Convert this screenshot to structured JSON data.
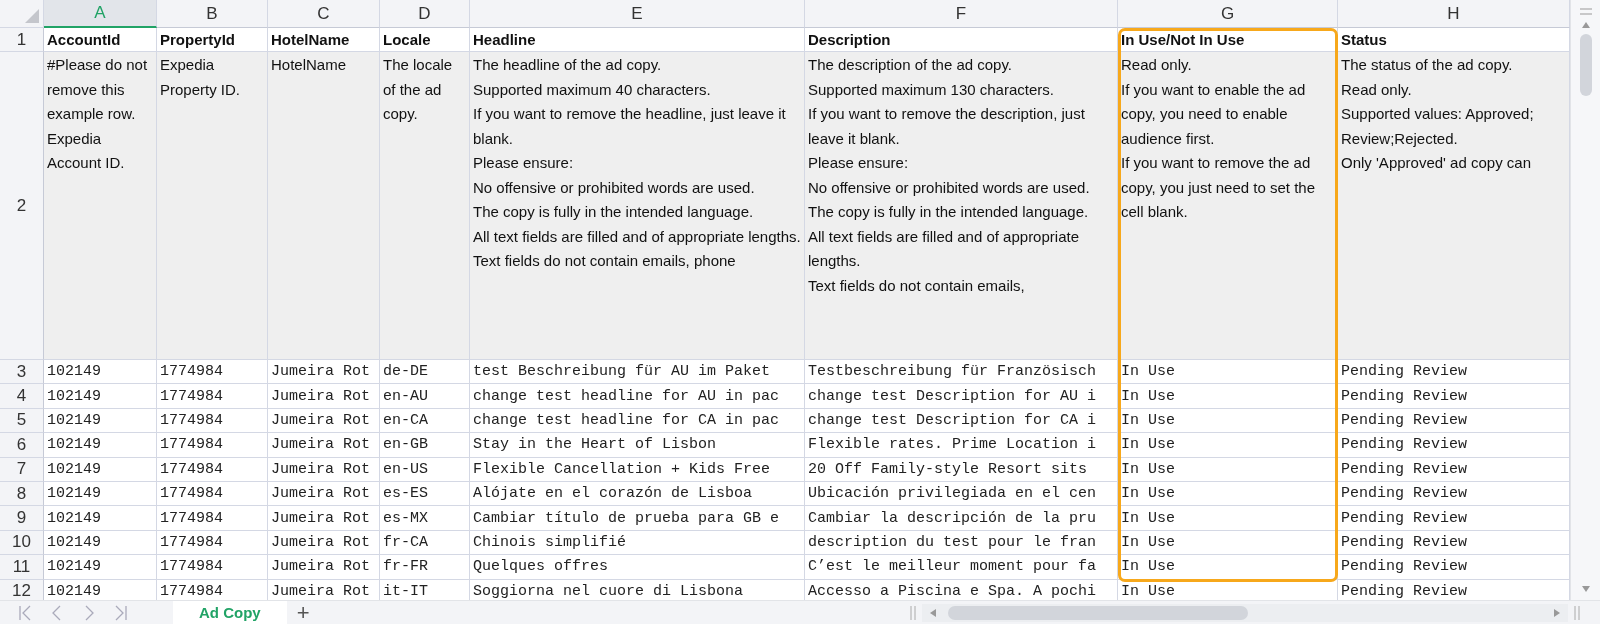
{
  "columns": [
    {
      "label": "A",
      "selected": true,
      "highlighted": false
    },
    {
      "label": "B",
      "selected": false,
      "highlighted": false
    },
    {
      "label": "C",
      "selected": false,
      "highlighted": false
    },
    {
      "label": "D",
      "selected": false,
      "highlighted": false
    },
    {
      "label": "E",
      "selected": false,
      "highlighted": false
    },
    {
      "label": "F",
      "selected": false,
      "highlighted": false
    },
    {
      "label": "G",
      "selected": false,
      "highlighted": true
    },
    {
      "label": "H",
      "selected": false,
      "highlighted": false
    }
  ],
  "rows": [
    {
      "number": "1",
      "kind": "header",
      "cells": [
        "AccountId",
        "PropertyId",
        "HotelName",
        "Locale",
        "Headline",
        "Description",
        "In Use/Not In Use",
        "Status"
      ]
    },
    {
      "number": "2",
      "kind": "notes",
      "cells": [
        "#Please do not remove this example row.\nExpedia Account ID.",
        "Expedia Property ID.",
        "HotelName",
        "The locale of the ad copy.",
        "The headline of the ad copy.\nSupported maximum 40 characters.\nIf you want to remove the headline, just leave it blank.\nPlease ensure:\nNo offensive or prohibited words are used.\nThe copy is fully in the intended language.\nAll text fields are filled and of appropriate lengths.\nText fields do not contain emails, phone",
        "The description of the ad copy.\nSupported maximum 130 characters.\nIf you want to remove the description, just leave it blank.\nPlease ensure:\nNo offensive or prohibited words are used.\nThe copy is fully in the intended language.\nAll text fields are filled and of appropriate lengths.\nText fields do not contain emails,",
        "Read only.\nIf you want to enable the ad copy, you need to enable audience first.\nIf you want to remove the ad copy, you just need to set the cell blank.",
        "The status of the ad copy.\nRead only.\nSupported values: Approved;\nReview;Rejected.\nOnly 'Approved' ad copy can"
      ]
    },
    {
      "number": "3",
      "kind": "data",
      "cells": [
        "102149",
        "1774984",
        "Jumeira Rot",
        "de-DE",
        "test Beschreibung für AU im Paket",
        "Testbeschreibung für Französisch",
        "In Use",
        "Pending Review"
      ]
    },
    {
      "number": "4",
      "kind": "data",
      "cells": [
        "102149",
        "1774984",
        "Jumeira Rot",
        "en-AU",
        "change test headline for AU in pac",
        "change test Description for AU i",
        "In Use",
        "Pending Review"
      ]
    },
    {
      "number": "5",
      "kind": "data",
      "cells": [
        "102149",
        "1774984",
        "Jumeira Rot",
        "en-CA",
        "change test headline for CA in pac",
        "change test Description for CA i",
        "In Use",
        "Pending Review"
      ]
    },
    {
      "number": "6",
      "kind": "data",
      "cells": [
        "102149",
        "1774984",
        "Jumeira Rot",
        "en-GB",
        "Stay in the Heart of Lisbon",
        "Flexible rates. Prime Location i",
        "In Use",
        "Pending Review"
      ]
    },
    {
      "number": "7",
      "kind": "data",
      "cells": [
        "102149",
        "1774984",
        "Jumeira Rot",
        "en-US",
        "Flexible Cancellation + Kids Free",
        "20 Off Family-style Resort sits",
        "In Use",
        "Pending Review"
      ]
    },
    {
      "number": "8",
      "kind": "data",
      "cells": [
        "102149",
        "1774984",
        "Jumeira Rot",
        "es-ES",
        "Alójate en el corazón de Lisboa",
        "Ubicación privilegiada en el cen",
        "In Use",
        "Pending Review"
      ]
    },
    {
      "number": "9",
      "kind": "data",
      "cells": [
        "102149",
        "1774984",
        "Jumeira Rot",
        "es-MX",
        "Cambiar título de prueba para GB e",
        "Cambiar la descripción de la pru",
        "In Use",
        "Pending Review"
      ]
    },
    {
      "number": "10",
      "kind": "data",
      "cells": [
        "102149",
        "1774984",
        "Jumeira Rot",
        "fr-CA",
        "Chinois simplifié",
        "description du test pour le fran",
        "In Use",
        "Pending Review"
      ]
    },
    {
      "number": "11",
      "kind": "data",
      "cells": [
        "102149",
        "1774984",
        "Jumeira Rot",
        "fr-FR",
        "Quelques offres",
        "C’est le meilleur moment pour fa",
        "In Use",
        "Pending Review"
      ]
    },
    {
      "number": "12",
      "kind": "data",
      "cells": [
        "102149",
        "1774984",
        "Jumeira Rot",
        "it-IT",
        "Soggiorna nel cuore di Lisbona",
        "Accesso a Piscina e Spa. A pochi",
        "In Use",
        "Pending Review"
      ]
    }
  ],
  "sheet_tabs": [
    {
      "label": "Ad Copy",
      "selected": true
    }
  ],
  "add_sheet": "+"
}
